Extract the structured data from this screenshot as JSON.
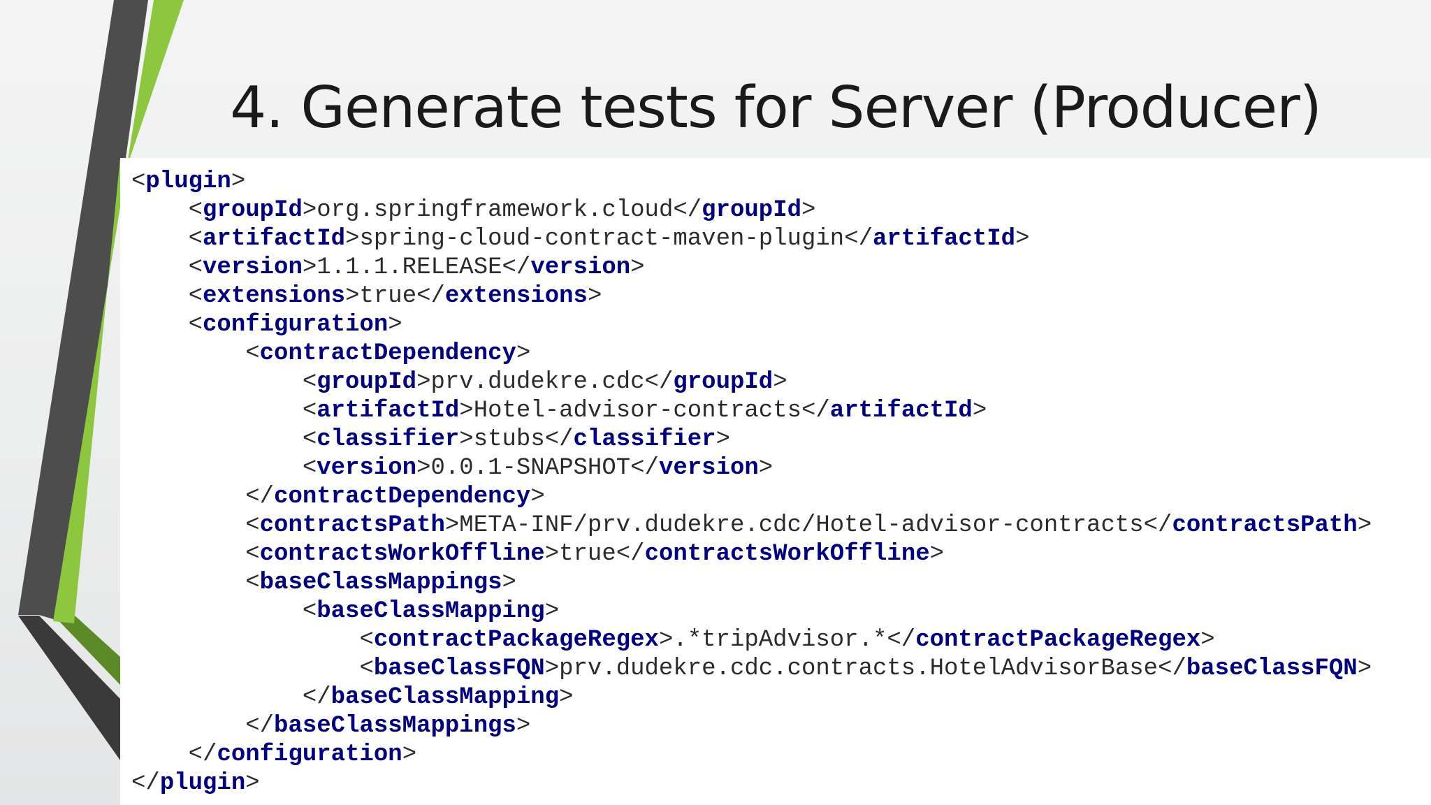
{
  "slide": {
    "title": "4. Generate tests for Server (Producer)"
  },
  "colors": {
    "tag": "#000080",
    "text": "#2b2b2b",
    "accent_green": "#8dc63f",
    "accent_gray": "#4d4d4d"
  },
  "code": {
    "lines": [
      {
        "indent": 0,
        "open": "plugin",
        "text": null,
        "close": null
      },
      {
        "indent": 1,
        "open": "groupId",
        "text": "org.springframework.cloud",
        "close": "groupId"
      },
      {
        "indent": 1,
        "open": "artifactId",
        "text": "spring-cloud-contract-maven-plugin",
        "close": "artifactId"
      },
      {
        "indent": 1,
        "open": "version",
        "text": "1.1.1.RELEASE",
        "close": "version"
      },
      {
        "indent": 1,
        "open": "extensions",
        "text": "true",
        "close": "extensions"
      },
      {
        "indent": 1,
        "open": "configuration",
        "text": null,
        "close": null
      },
      {
        "indent": 2,
        "open": "contractDependency",
        "text": null,
        "close": null
      },
      {
        "indent": 3,
        "open": "groupId",
        "text": "prv.dudekre.cdc",
        "close": "groupId"
      },
      {
        "indent": 3,
        "open": "artifactId",
        "text": "Hotel-advisor-contracts",
        "close": "artifactId"
      },
      {
        "indent": 3,
        "open": "classifier",
        "text": "stubs",
        "close": "classifier"
      },
      {
        "indent": 3,
        "open": "version",
        "text": "0.0.1-SNAPSHOT",
        "close": "version"
      },
      {
        "indent": 2,
        "open": null,
        "text": null,
        "close": "contractDependency"
      },
      {
        "indent": 2,
        "open": "contractsPath",
        "text": "META-INF/prv.dudekre.cdc/Hotel-advisor-contracts",
        "close": "contractsPath"
      },
      {
        "indent": 2,
        "open": "contractsWorkOffline",
        "text": "true",
        "close": "contractsWorkOffline"
      },
      {
        "indent": 2,
        "open": "baseClassMappings",
        "text": null,
        "close": null
      },
      {
        "indent": 3,
        "open": "baseClassMapping",
        "text": null,
        "close": null
      },
      {
        "indent": 4,
        "open": "contractPackageRegex",
        "text": ".*tripAdvisor.*",
        "close": "contractPackageRegex"
      },
      {
        "indent": 4,
        "open": "baseClassFQN",
        "text": "prv.dudekre.cdc.contracts.HotelAdvisorBase",
        "close": "baseClassFQN"
      },
      {
        "indent": 3,
        "open": null,
        "text": null,
        "close": "baseClassMapping"
      },
      {
        "indent": 2,
        "open": null,
        "text": null,
        "close": "baseClassMappings"
      },
      {
        "indent": 1,
        "open": null,
        "text": null,
        "close": "configuration"
      },
      {
        "indent": 0,
        "open": null,
        "text": null,
        "close": "plugin"
      }
    ]
  }
}
